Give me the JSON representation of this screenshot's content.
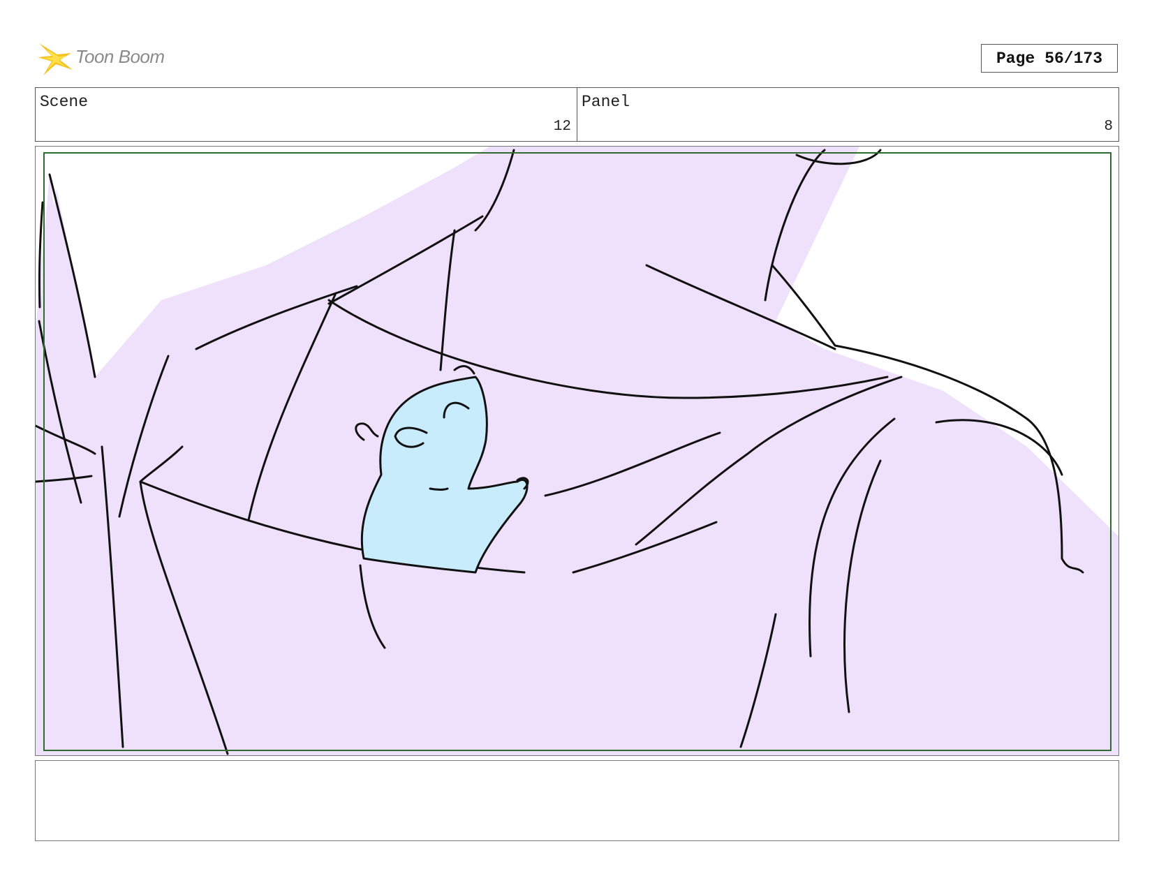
{
  "header": {
    "logo_text": "Toon Boom",
    "logo_icon": "starburst-logo-icon",
    "page_label": "Page",
    "page_number": "56/173"
  },
  "info": {
    "scene_label": "Scene",
    "scene_value": "12",
    "panel_label": "Panel",
    "panel_value": "8"
  },
  "panel_image": {
    "description_icon": "storyboard-drawing",
    "colors": {
      "jacket": "#efe0fb",
      "creature": "#c8ecfb",
      "safe_frame": "#2e6b2e",
      "line": "#111111"
    }
  },
  "notes": {
    "text": ""
  }
}
